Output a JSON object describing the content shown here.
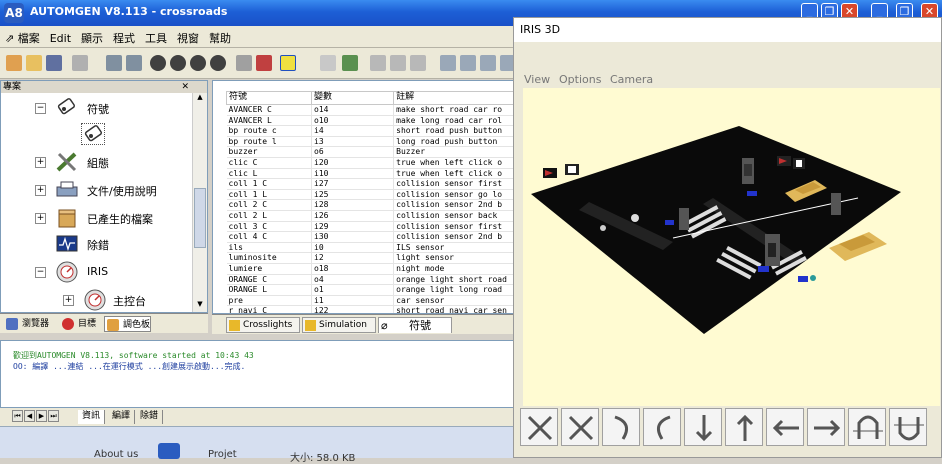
{
  "app": {
    "logo_text": "A8",
    "title": "AUTOMGEN V8.113 - crossroads"
  },
  "window_controls": {
    "minimize": "_",
    "restore": "❐",
    "close": "✕"
  },
  "menu": [
    "檔案",
    "Edit",
    "顯示",
    "程式",
    "工具",
    "視窗",
    "幫助"
  ],
  "tree": {
    "header": "專案",
    "items": [
      {
        "label": "符號",
        "icon": "tag-icon",
        "expander": "−"
      },
      {
        "label": "",
        "icon": "tag-icon",
        "expander": ""
      },
      {
        "label": "組態",
        "icon": "tools-icon",
        "expander": "+"
      },
      {
        "label": "文件/使用說明",
        "icon": "printer-icon",
        "expander": "+"
      },
      {
        "label": "已產生的檔案",
        "icon": "box-icon",
        "expander": "+"
      },
      {
        "label": "除錯",
        "icon": "monitor-icon",
        "expander": ""
      },
      {
        "label": "IRIS",
        "icon": "gauge-icon",
        "expander": "−"
      },
      {
        "label": "主控台",
        "icon": "gauge-icon",
        "expander": "+"
      }
    ]
  },
  "left_tabs": [
    "瀏覽器",
    "目標",
    "調色板"
  ],
  "symbols": {
    "headers": [
      "符號",
      "變數",
      "註解"
    ],
    "rows": [
      [
        "AVANCER C",
        "o14",
        "make short road car ro"
      ],
      [
        "AVANCER L",
        "o10",
        "make long road car rol"
      ],
      [
        "bp route c",
        "i4",
        "short road push button"
      ],
      [
        "bp route l",
        "i3",
        "long road push button"
      ],
      [
        "buzzer",
        "o6",
        "Buzzer"
      ],
      [
        "clic C",
        "i20",
        "true when left click o"
      ],
      [
        "clic L",
        "i10",
        "true when left click o"
      ],
      [
        "coll 1 C",
        "i27",
        "collision sensor first"
      ],
      [
        "coll 1 L",
        "i25",
        "collision sensor go lo"
      ],
      [
        "coll 2 C",
        "i28",
        "collision sensor 2nd b"
      ],
      [
        "coll 2 L",
        "i26",
        "collision sensor back"
      ],
      [
        "coll 3 C",
        "i29",
        "collision sensor first"
      ],
      [
        "coll 4 C",
        "i30",
        "collision sensor 2nd b"
      ],
      [
        "ils",
        "i0",
        "ILS sensor"
      ],
      [
        "luminosite",
        "i2",
        "light sensor"
      ],
      [
        "lumiere",
        "o18",
        "night mode"
      ],
      [
        "ORANGE C",
        "o4",
        "orange light short road"
      ],
      [
        "ORANGE L",
        "o1",
        "orange light long road"
      ],
      [
        "pre",
        "i1",
        "car sensor"
      ],
      [
        "r navi C",
        "i22",
        "short road navi car sen"
      ]
    ]
  },
  "doc_tabs": [
    "Crosslights",
    "Simulation",
    "符號"
  ],
  "log": {
    "line1": "歡迎到AUTOMGEN V8.113, software started at 10:43 43",
    "line2": "OO:  編譯 ...連結 ...在運行模式 ...創建展示啟動...完成."
  },
  "log_tabs": [
    "資訊",
    "編譯",
    "除錯"
  ],
  "bottom": {
    "about": "About us",
    "projet": "Projet",
    "size": "大小: 58.0 KB"
  },
  "iris": {
    "title": "IRIS 3D",
    "menu": [
      "View",
      "Options",
      "Camera"
    ],
    "buttons": [
      "zoom-in-icon",
      "zoom-out-icon",
      "rotate-cw-icon",
      "rotate-ccw-icon",
      "arrow-down-icon",
      "arrow-up-icon",
      "arrow-left-icon",
      "arrow-right-icon",
      "tilt-up-icon",
      "tilt-down-icon"
    ]
  },
  "colors": {
    "titlebar": "#1d5fd6",
    "scene_background": "#fffbd2",
    "road": "#0a0a0a",
    "car": "#e0b85a"
  }
}
